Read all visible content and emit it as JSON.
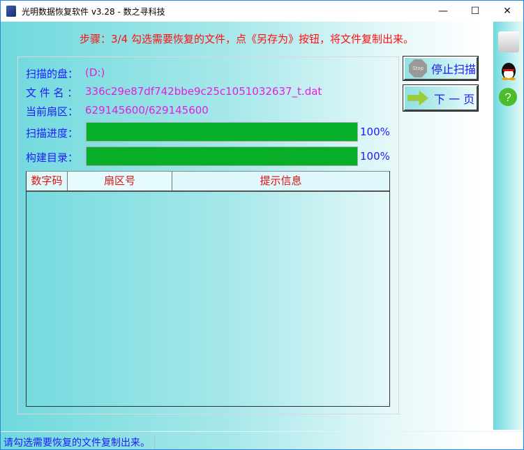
{
  "window": {
    "title": "光明数据恢复软件 v3.28 - 数之寻科技",
    "minimize": "—",
    "maximize": "☐",
    "close": "✕"
  },
  "step_text": "步骤：3/4 勾选需要恢复的文件，点《另存为》按钮，将文件复制出来。",
  "info": {
    "disk_label": "扫描的盘：",
    "disk_value": "(D:)",
    "file_label": "文 件 名 ：",
    "file_value": "336c29e87df742bbe9c25c1051032637_t.dat",
    "sector_label": "当前扇区：",
    "sector_value": "629145600/629145600"
  },
  "progress": [
    {
      "label": "扫描进度：",
      "percent": 100,
      "text": "100%"
    },
    {
      "label": "构建目录：",
      "percent": 100,
      "text": "100%"
    }
  ],
  "table": {
    "columns": [
      "数字码",
      "扇区号",
      "提示信息"
    ],
    "rows": []
  },
  "buttons": {
    "stop": "停止扫描",
    "stop_icon_text": "Stop",
    "next": "下 一 页"
  },
  "status": "请勾选需要恢复的文件复制出来。",
  "colors": {
    "accent": "#1a1aff",
    "value": "#e020e0",
    "warning": "#ff1010",
    "progress": "#06af27"
  }
}
